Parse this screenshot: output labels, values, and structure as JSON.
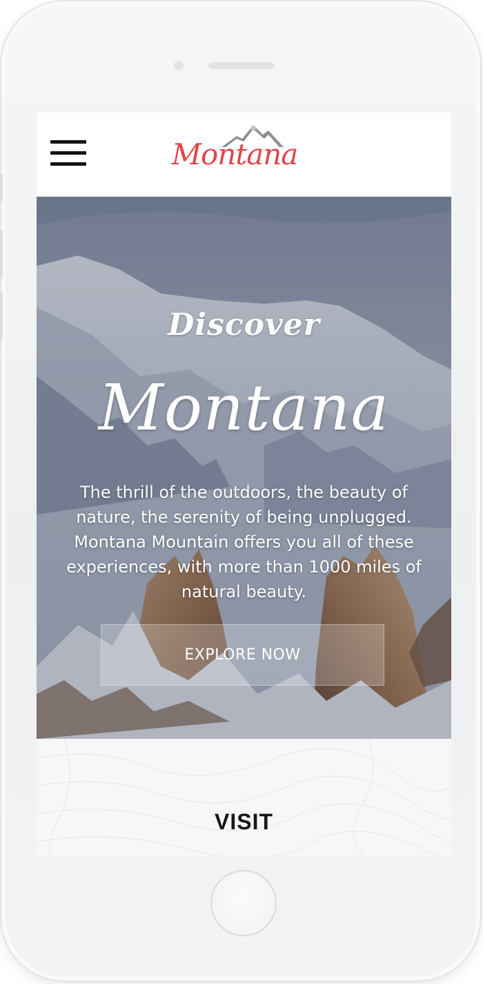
{
  "header": {
    "menu_icon": "hamburger-menu-icon",
    "logo_icon": "mountain-peaks-icon",
    "logo_text": "Montana"
  },
  "hero": {
    "kicker": "Discover",
    "title": "Montana",
    "description": "The thrill of the outdoors, the beauty of nature, the serenity of being unplugged. Montana Mountain offers you all of these experiences, with more than 1000 miles of natural beauty.",
    "cta_label": "EXPLORE NOW"
  },
  "visit": {
    "title": "VISIT"
  },
  "colors": {
    "brand_red": "#e0464a",
    "text_dark": "#161616",
    "hero_text": "#ffffff"
  }
}
